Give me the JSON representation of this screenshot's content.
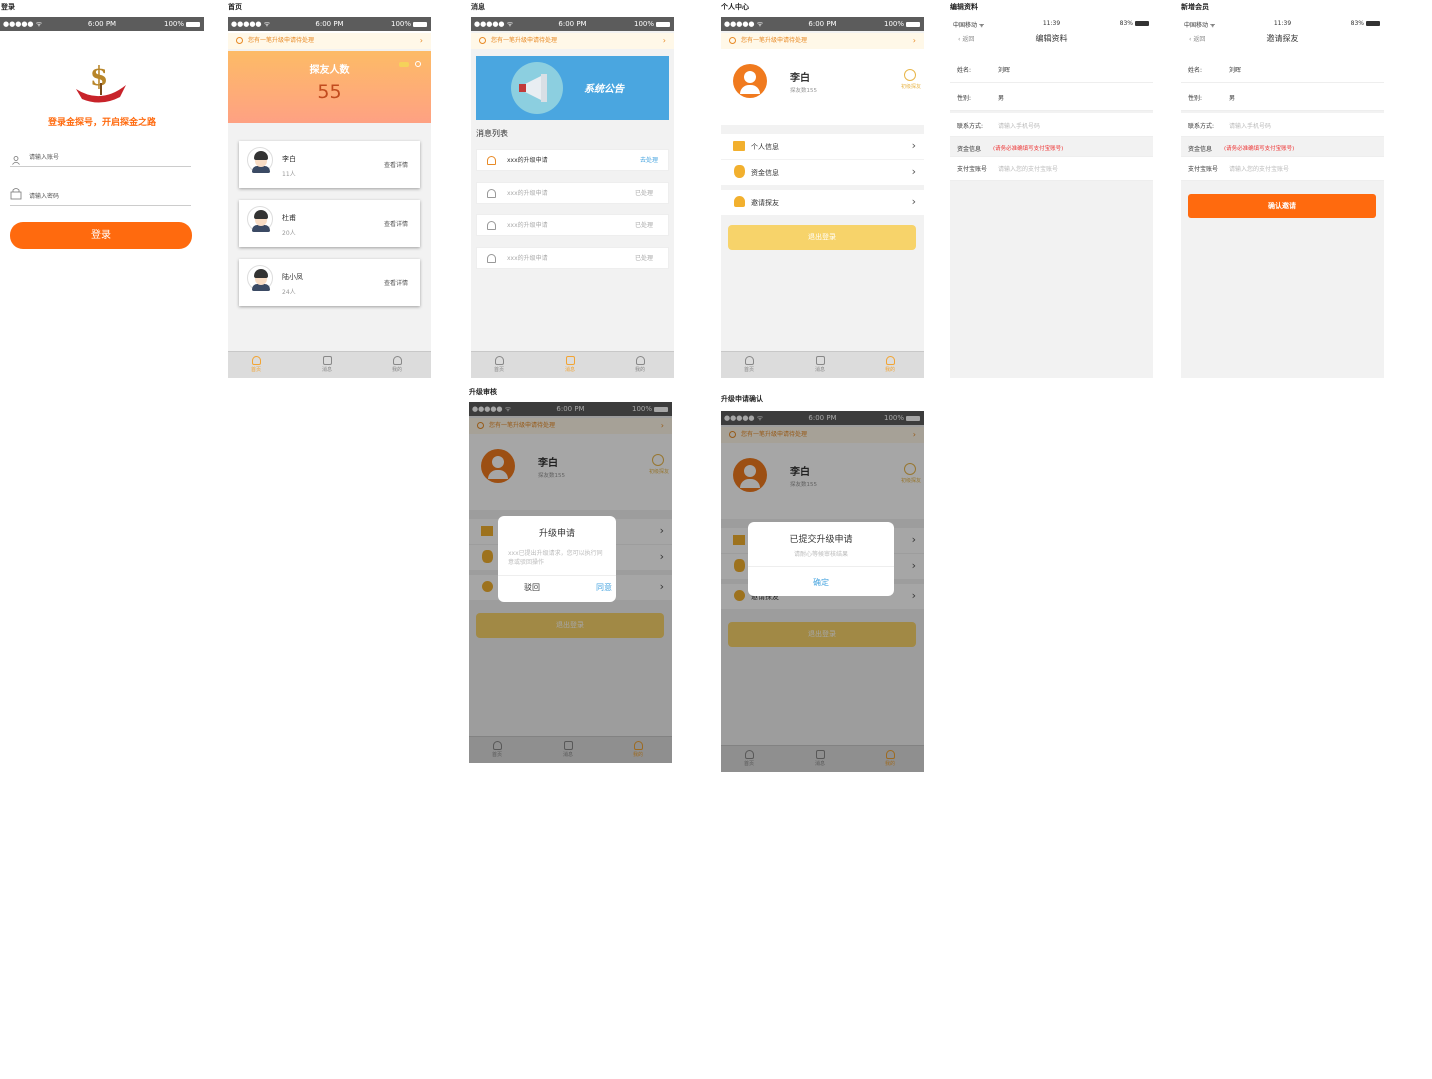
{
  "labels": {
    "login": "登录",
    "home": "首页",
    "messages": "消息",
    "profile": "个人中心",
    "edit": "编辑资料",
    "add_member": "新增会员",
    "upgrade_review": "升级审核",
    "upgrade_confirm": "升级申请确认"
  },
  "status": {
    "signal": "●●●●● ᯤ",
    "time": "6:00 PM",
    "battery": "100%",
    "carrier": "中国移动 ᯤ",
    "time2": "11:39",
    "battery2": "83%"
  },
  "notice_text": "您有一笔升级申请待处理",
  "login": {
    "slogan": "登录金探号，开启探金之路",
    "account_placeholder": "请输入账号",
    "password_placeholder": "请输入密码",
    "button": "登录"
  },
  "home": {
    "banner_title": "探友人数",
    "banner_count": "55",
    "detail_label": "查看详情",
    "friends": [
      {
        "name": "李白",
        "count": "11人"
      },
      {
        "name": "杜甫",
        "count": "20人"
      },
      {
        "name": "陆小凤",
        "count": "24人"
      }
    ]
  },
  "tabs": {
    "home": "首页",
    "message": "消息",
    "mine": "我的"
  },
  "messages": {
    "banner_text": "系统公告",
    "list_title": "消息列表",
    "items": [
      {
        "text": "xxx的升级申请",
        "status": "去处理"
      },
      {
        "text": "xxx的升级申请",
        "status": "已处理"
      },
      {
        "text": "xxx的升级申请",
        "status": "已处理"
      },
      {
        "text": "xxx的升级申请",
        "status": "已处理"
      }
    ]
  },
  "profile": {
    "name": "李白",
    "sub": "探友数155",
    "badge": "初级探友",
    "menu": [
      "个人信息",
      "资金信息",
      "邀请探友"
    ],
    "logout": "退出登录"
  },
  "edit": {
    "back": "返回",
    "title": "编辑资料",
    "name_label": "姓名:",
    "name_value": "刘晖",
    "gender_label": "性别:",
    "gender_value": "男",
    "contact_label": "联系方式:",
    "contact_placeholder": "请输入手机号码",
    "fund_label": "资金信息",
    "fund_warning": "(请务必准确填写支付宝账号)",
    "alipay_label": "支付宝账号",
    "alipay_placeholder": "请输入您的支付宝账号"
  },
  "invite": {
    "title": "邀请探友",
    "button": "确认邀请"
  },
  "review_dialog": {
    "title": "升级申请",
    "body": "xxx已提出升级请求，您可以执行同意或驳回操作",
    "reject": "驳回",
    "agree": "同意"
  },
  "confirm_dialog": {
    "title": "已提交升级申请",
    "body": "请耐心等候审核结果",
    "ok": "确定"
  },
  "colors": {
    "accent": "#ff6a0e",
    "notice": "#e88a26",
    "yellow": "#f7d36a",
    "blue": "#4aa6e0"
  }
}
